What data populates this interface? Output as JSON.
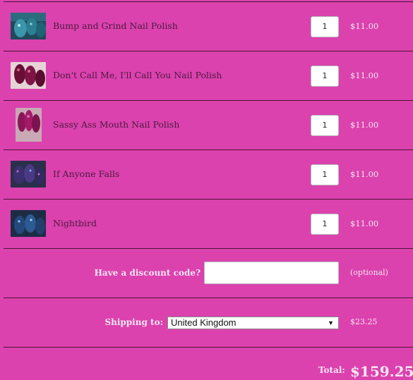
{
  "cart": {
    "items": [
      {
        "name": "Bump and Grind Nail Polish",
        "quantity": "1",
        "price": "$11.00",
        "image": "teal-glitter-nails"
      },
      {
        "name": "Don't Call Me, I'll Call You Nail Polish",
        "quantity": "1",
        "price": "$11.00",
        "image": "plum-nails"
      },
      {
        "name": "Sassy Ass Mouth Nail Polish",
        "quantity": "1",
        "price": "$11.00",
        "image": "magenta-nails"
      },
      {
        "name": "If Anyone Falls",
        "quantity": "1",
        "price": "$11.00",
        "image": "purple-galaxy-nails"
      },
      {
        "name": "Nightbird",
        "quantity": "1",
        "price": "$11.00",
        "image": "blue-shimmer-nails"
      }
    ],
    "discount": {
      "label": "Have a discount code?",
      "value": "",
      "note": "(optional)"
    },
    "shipping": {
      "label": "Shipping to:",
      "selected_country": "United Kingdom",
      "price": "$23.25"
    },
    "total": {
      "label": "Total:",
      "value": "$159.25"
    }
  },
  "colors": {
    "background": "#db42ae",
    "divider": "#4a1438",
    "text_dark": "#4d1a40",
    "text_light": "#f7e3f1"
  }
}
